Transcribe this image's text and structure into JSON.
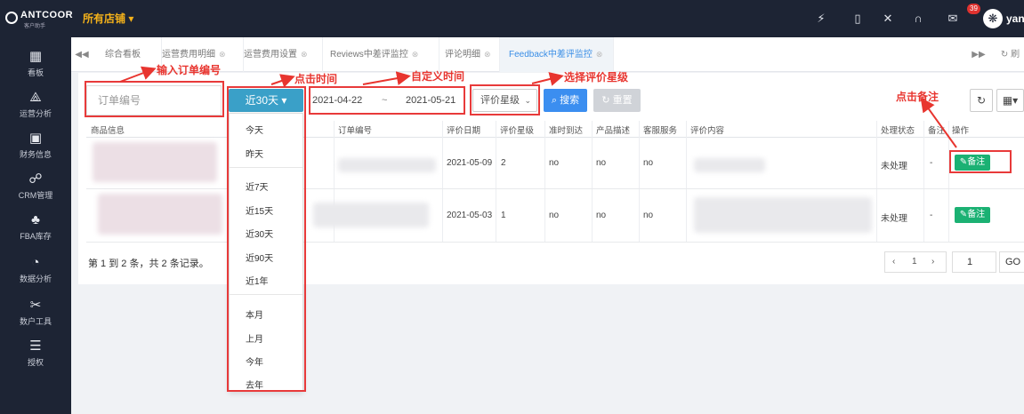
{
  "topbar": {
    "logo_text": "ANTCOOR",
    "logo_sub": "客户助手",
    "store": "所有店铺 ▾",
    "mail_badge": "39",
    "username": "yans"
  },
  "sidebar": {
    "items": [
      {
        "icon": "dashboard-icon",
        "glyph": "▦",
        "label": "看板"
      },
      {
        "icon": "analysis-icon",
        "glyph": "⟁",
        "label": "运营分析"
      },
      {
        "icon": "finance-icon",
        "glyph": "▣",
        "label": "财务信息"
      },
      {
        "icon": "crm-icon",
        "glyph": "☍",
        "label": "CRM管理"
      },
      {
        "icon": "fba-icon",
        "glyph": "♣",
        "label": "FBA库存"
      },
      {
        "icon": "data-icon",
        "glyph": "◔",
        "label": "数据分析"
      },
      {
        "icon": "tools-icon",
        "glyph": "✂",
        "label": "数户工具"
      },
      {
        "icon": "auth-icon",
        "glyph": "☰",
        "label": "授权"
      }
    ]
  },
  "tabs": {
    "items": [
      {
        "label": "综合看板"
      },
      {
        "label": "运营费用明细"
      },
      {
        "label": "运营费用设置"
      },
      {
        "label": "Reviews中差评监控"
      },
      {
        "label": "评论明细"
      },
      {
        "label": "Feedback中差评监控"
      }
    ],
    "refresh": "刷"
  },
  "filters": {
    "order_placeholder": "订单编号",
    "range_button": "近30天 ▾",
    "date_start": "2021-04-22",
    "date_sep": "~",
    "date_end": "2021-05-21",
    "star_select": "评价星级",
    "search": "搜索",
    "reset": "重置"
  },
  "dropdown": {
    "items": [
      "今天",
      "昨天",
      "近7天",
      "近15天",
      "近30天",
      "近90天",
      "近1年",
      "本月",
      "上月",
      "今年",
      "去年"
    ]
  },
  "table": {
    "headers": [
      "商品信息",
      "订单编号",
      "评价日期",
      "评价星级",
      "准时到达",
      "产品描述",
      "客服服务",
      "评价内容",
      "处理状态",
      "备注",
      "操作"
    ],
    "rows": [
      {
        "date": "2021-05-09",
        "star": "2",
        "ontime": "no",
        "desc": "no",
        "service": "no",
        "status": "未处理",
        "note": "-",
        "action": "备注"
      },
      {
        "date": "2021-05-03",
        "star": "1",
        "ontime": "no",
        "desc": "no",
        "service": "no",
        "status": "未处理",
        "note": "-",
        "action": "备注"
      }
    ],
    "footer": "第 1 到 2 条，共 2 条记录。",
    "page": "1",
    "goto_value": "1",
    "go": "GO"
  },
  "annotations": {
    "input_order": "输入订单编号",
    "click_time": "点击时间",
    "custom_time": "自定义时间",
    "select_star": "选择评价星级",
    "click_note": "点击备注"
  },
  "colors": {
    "dark_nav": "#1d2434",
    "accent": "#3aa0c8",
    "search": "#3b8ef0",
    "note_button": "#1bb173",
    "annotation_red": "#e83a3a",
    "store_gold": "#f5b21a"
  }
}
